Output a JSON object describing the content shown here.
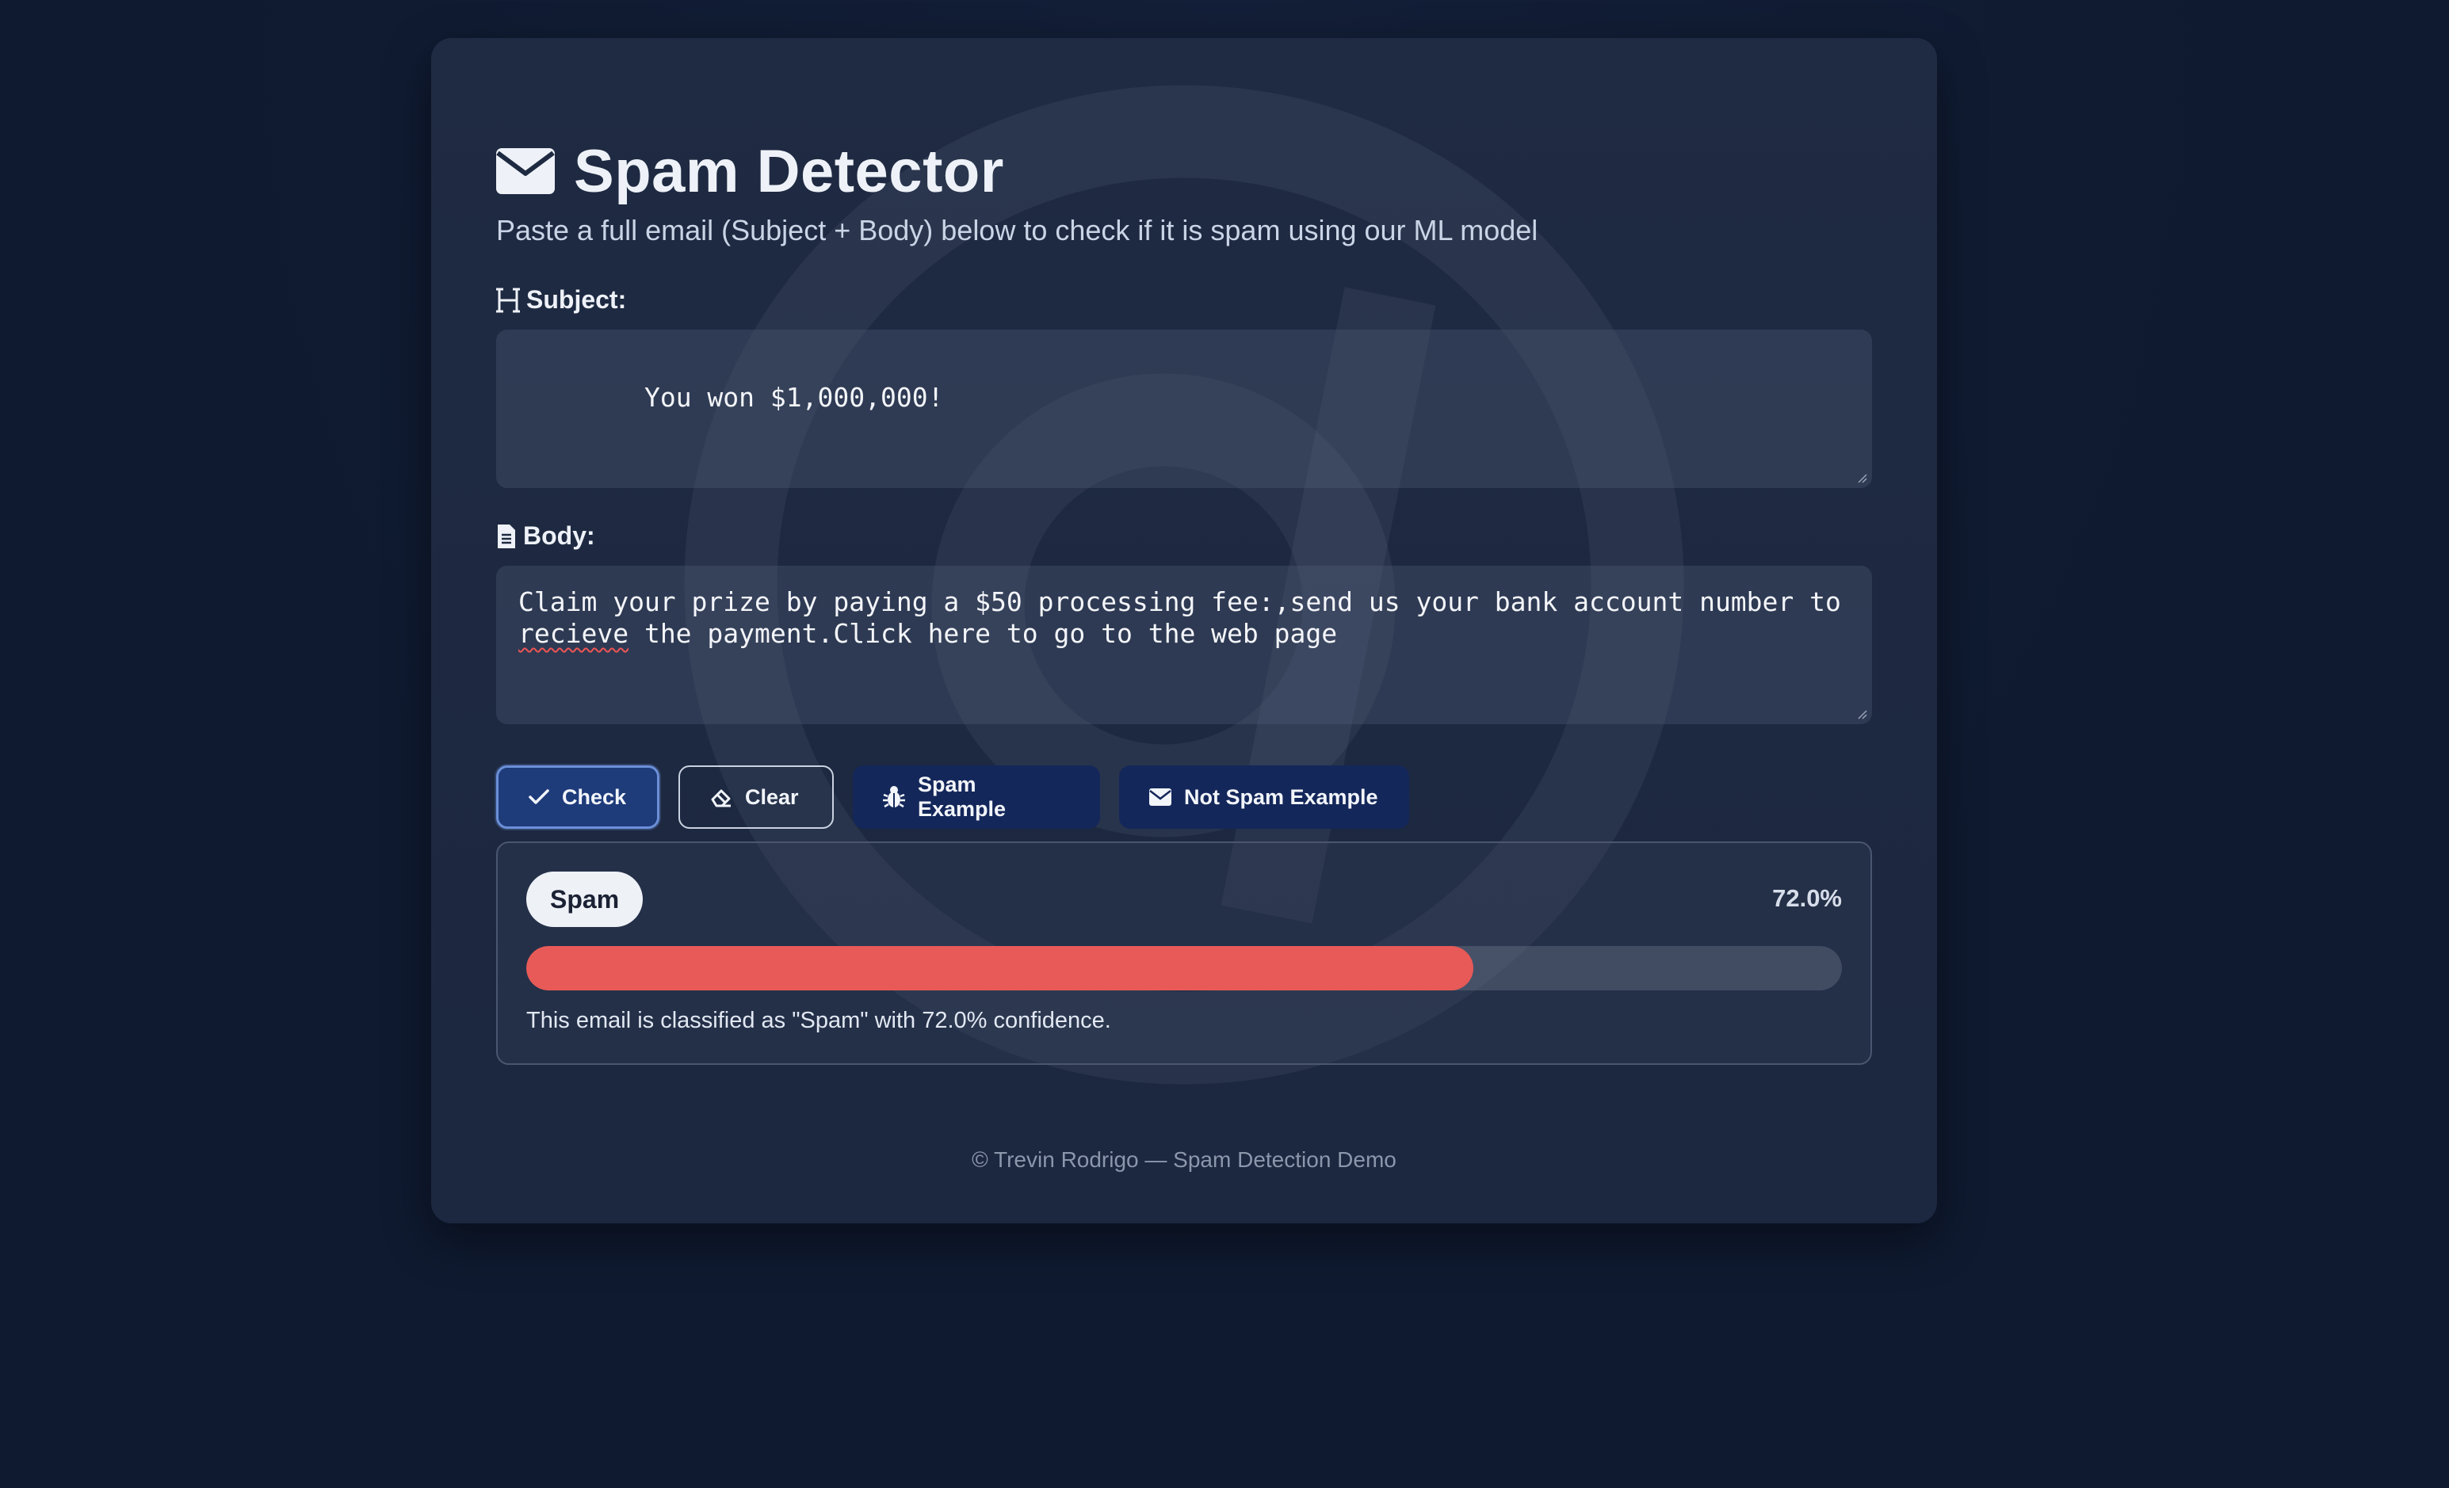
{
  "app": {
    "title": "Spam Detector",
    "subtitle": "Paste a full email (Subject + Body) below to check if it is spam using our ML model"
  },
  "form": {
    "subject_label": "Subject:",
    "subject_value": "You won $1,000,000!",
    "body_label": "Body:",
    "body_value_part1": "Claim your prize by paying a $50 processing fee:,send us your bank account number to ",
    "body_value_misspelled": "recieve",
    "body_value_part2": " the payment.Click here to go to the web page"
  },
  "buttons": {
    "check": "Check",
    "clear": "Clear",
    "spam_example": "Spam Example",
    "not_spam_example": "Not Spam Example"
  },
  "result": {
    "label": "Spam",
    "confidence_text": "72.0%",
    "confidence": 0.72,
    "message": "This email is classified as \"Spam\" with 72.0% confidence.",
    "bar_color": "#e85a57"
  },
  "footer": {
    "text": "© Trevin Rodrigo — Spam Detection Demo"
  },
  "icons": {
    "title": "envelope-icon",
    "subject": "heading-icon",
    "body": "file-text-icon",
    "check": "checkmark-icon",
    "clear": "eraser-icon",
    "spam_example": "bug-icon",
    "not_spam_example": "envelope-icon"
  }
}
